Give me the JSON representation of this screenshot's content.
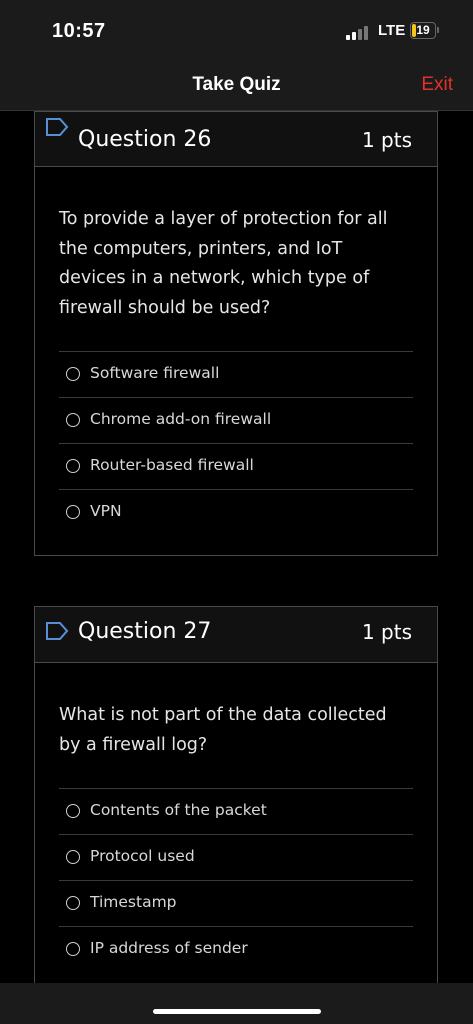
{
  "status": {
    "time": "10:57",
    "network": "LTE",
    "battery": "19",
    "battery_percent": 19
  },
  "nav": {
    "title": "Take Quiz",
    "exit_label": "Exit",
    "exit_color": "#e0312c"
  },
  "questions": [
    {
      "title": "Question 26",
      "points": "1 pts",
      "text": "To provide a layer of protection for all the computers, printers, and IoT devices in a network, which type of firewall should be used?",
      "answers": [
        "Software firewall",
        "Chrome add-on firewall",
        "Router-based firewall",
        "VPN"
      ],
      "flag_icon": "flag-outline-icon"
    },
    {
      "title": "Question 27",
      "points": "1 pts",
      "text": "What is not part of the data collected by a firewall log?",
      "answers": [
        "Contents of the packet",
        "Protocol used",
        "Timestamp",
        "IP address of sender"
      ],
      "flag_icon": "flag-outline-icon"
    }
  ]
}
